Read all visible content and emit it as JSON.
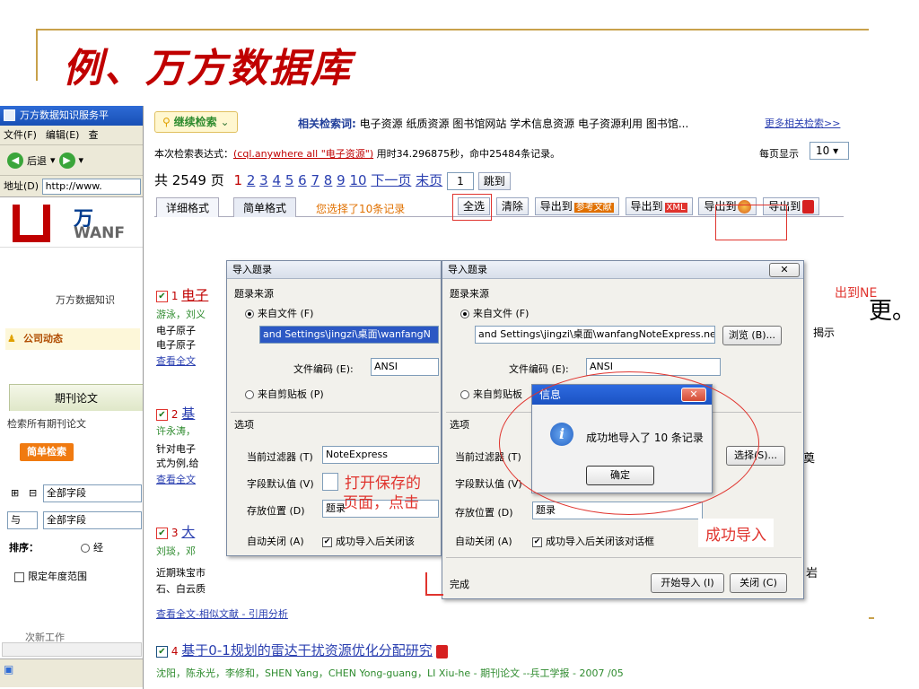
{
  "slide": {
    "title": "例、万方数据库"
  },
  "browser": {
    "title": "万方数据知识服务平",
    "menu": [
      "文件(F)",
      "编辑(E)",
      "查"
    ],
    "back": "后退",
    "address_label": "地址(D)",
    "address_value": "http://www.",
    "logo_brand": "WANF",
    "site_name": "万方数据知识",
    "news_label": "公司动态",
    "journal_tab": "期刊论文",
    "search_all": "检索所有期刊论文",
    "simple_search": "简单检索",
    "field1": "全部字段",
    "op2": "与",
    "field2": "全部字段",
    "sort_label": "排序：",
    "sort_option": "经",
    "year_limit": "限定年度范围",
    "more_label": "次新工作"
  },
  "page": {
    "continue_search": "继续检索",
    "related_label": "相关检索词:",
    "related_terms": [
      "电子资源",
      "纸质资源",
      "图书馆网站",
      "学术信息资源",
      "电子资源利用",
      "图书馆..."
    ],
    "more_related": "更多相关检索>>",
    "expr_prefix": "本次检索表达式：",
    "expr_link": "(cql.anywhere all \"电子资源\")",
    "expr_suffix": "用时34.296875秒，命中25484条记录。",
    "per_page_label": "每页显示",
    "per_page_value": "10",
    "total_pages": "共 2549 页",
    "pages": [
      "1",
      "2",
      "3",
      "4",
      "5",
      "6",
      "7",
      "8",
      "9",
      "10"
    ],
    "next_page": "下一页",
    "last_page": "末页",
    "page_input": "1",
    "goto": "跳到",
    "tab_detail": "详细格式",
    "tab_simple": "简单格式",
    "selected_msg": "您选择了10条记录",
    "select_all": "全选",
    "clear": "清除",
    "export_ref": "导出到",
    "export_ref_badge": "参考文献",
    "export_xml": "导出到",
    "export_xml_badge": "XML",
    "export_ne": "导出到",
    "export_pdf": "导出到",
    "results": [
      {
        "num": "1",
        "title": "电子",
        "authors": "游泳，刘义",
        "abs": "电子原子",
        "abs2": "电子原子",
        "view": "查看全文"
      },
      {
        "num": "2",
        "title": "基",
        "authors": "许永涛，",
        "abs": "针对电子",
        "abs2": "式为例,给",
        "view": "查看全文"
      },
      {
        "num": "3",
        "title": "大",
        "authors": "刘琰，邓",
        "abs": "近期珠宝市",
        "abs2": "石、白云质",
        "view": "查看全文-相似文献 - 引用分析"
      },
      {
        "num": "4",
        "title": "基于0-1规划的雷达干扰资源优化分配研究",
        "authors": "沈阳，陈永光，李修和，SHEN Yang，CHEN Yong-guang，LI Xiu-he - 期刊论文 --兵工学报 - 2007 /05"
      }
    ],
    "side_snips": [
      "揭示",
      "奠",
      "岩",
      "出到NE",
      "更。"
    ]
  },
  "dialog_small": {
    "title": "导入题录",
    "source": "题录来源",
    "from_file": "来自文件 (F)",
    "path": "and Settings\\jingzi\\桌面\\wanfangN",
    "encoding_label": "文件编码 (E):",
    "encoding": "ANSI",
    "from_clip": "来自剪贴板 (P)",
    "options": "选项",
    "filter_label": "当前过滤器 (T)",
    "filter": "NoteExpress",
    "default_label": "字段默认值 (V)",
    "save_label": "存放位置 (D)",
    "save": "题录",
    "autoclose_label": "自动关闭 (A)",
    "autoclose": "成功导入后关闭该"
  },
  "dialog_big": {
    "title": "导入题录",
    "source": "题录来源",
    "from_file": "来自文件 (F)",
    "path": "and Settings\\jingzi\\桌面\\wanfangNoteExpress.net",
    "browse": "浏览 (B)...",
    "encoding_label": "文件编码 (E):",
    "encoding": "ANSI",
    "from_clip": "来自剪贴板",
    "options": "选项",
    "filter_label": "当前过滤器 (T)",
    "choose": "选择(S)...",
    "default_label": "字段默认值 (V)",
    "save_label": "存放位置 (D)",
    "save": "题录",
    "autoclose_label": "自动关闭 (A)",
    "autoclose": "成功导入后关闭该对话框",
    "done": "完成",
    "start": "开始导入 (I)",
    "close": "关闭 (C)"
  },
  "info": {
    "title": "信息",
    "message": "成功地导入了 10 条记录",
    "ok": "确定"
  },
  "annotations": {
    "open_saved": "打开保存的",
    "page_click": "页面，点击",
    "success": "成功导入"
  }
}
